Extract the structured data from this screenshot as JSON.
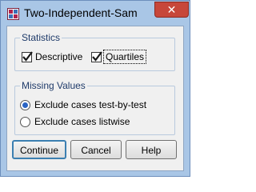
{
  "window": {
    "title": "Two-Independent-Sam",
    "close_label": "✕"
  },
  "statistics": {
    "legend": "Statistics",
    "descriptive": {
      "label": "Descriptive",
      "checked": true
    },
    "quartiles": {
      "label": "Quartiles",
      "checked": true
    }
  },
  "missing_values": {
    "legend": "Missing Values",
    "options": [
      {
        "label": "Exclude cases test-by-test",
        "selected": true
      },
      {
        "label": "Exclude cases listwise",
        "selected": false
      }
    ]
  },
  "buttons": {
    "continue": "Continue",
    "cancel": "Cancel",
    "help": "Help"
  },
  "colors": {
    "frame": "#a9c6e6",
    "close": "#c7473a",
    "legend_text": "#1f3b6a",
    "radio_dot": "#2a64c4"
  }
}
